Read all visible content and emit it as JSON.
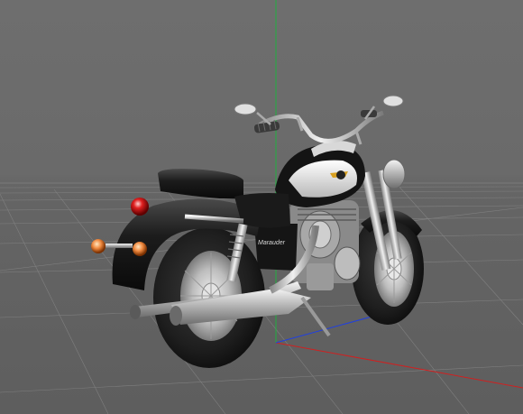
{
  "viewport": {
    "background": "#6a6a6a",
    "horizon_color": "#7c7c7c",
    "grid_color": "#8a8a8a",
    "axis_colors": {
      "x": "#d02020",
      "y": "#20b040",
      "z": "#2040e0"
    }
  },
  "model": {
    "name": "motorcycle-cruiser",
    "body_color": "#1a1a1a",
    "chrome_color": "#c8c8c8",
    "tank_panel_color": "#e6e6e6",
    "tail_light_color": "#e02020",
    "indicator_color": "#f08a40",
    "side_cover_badge": "Marauder",
    "tank_emblem": "winged-badge"
  }
}
